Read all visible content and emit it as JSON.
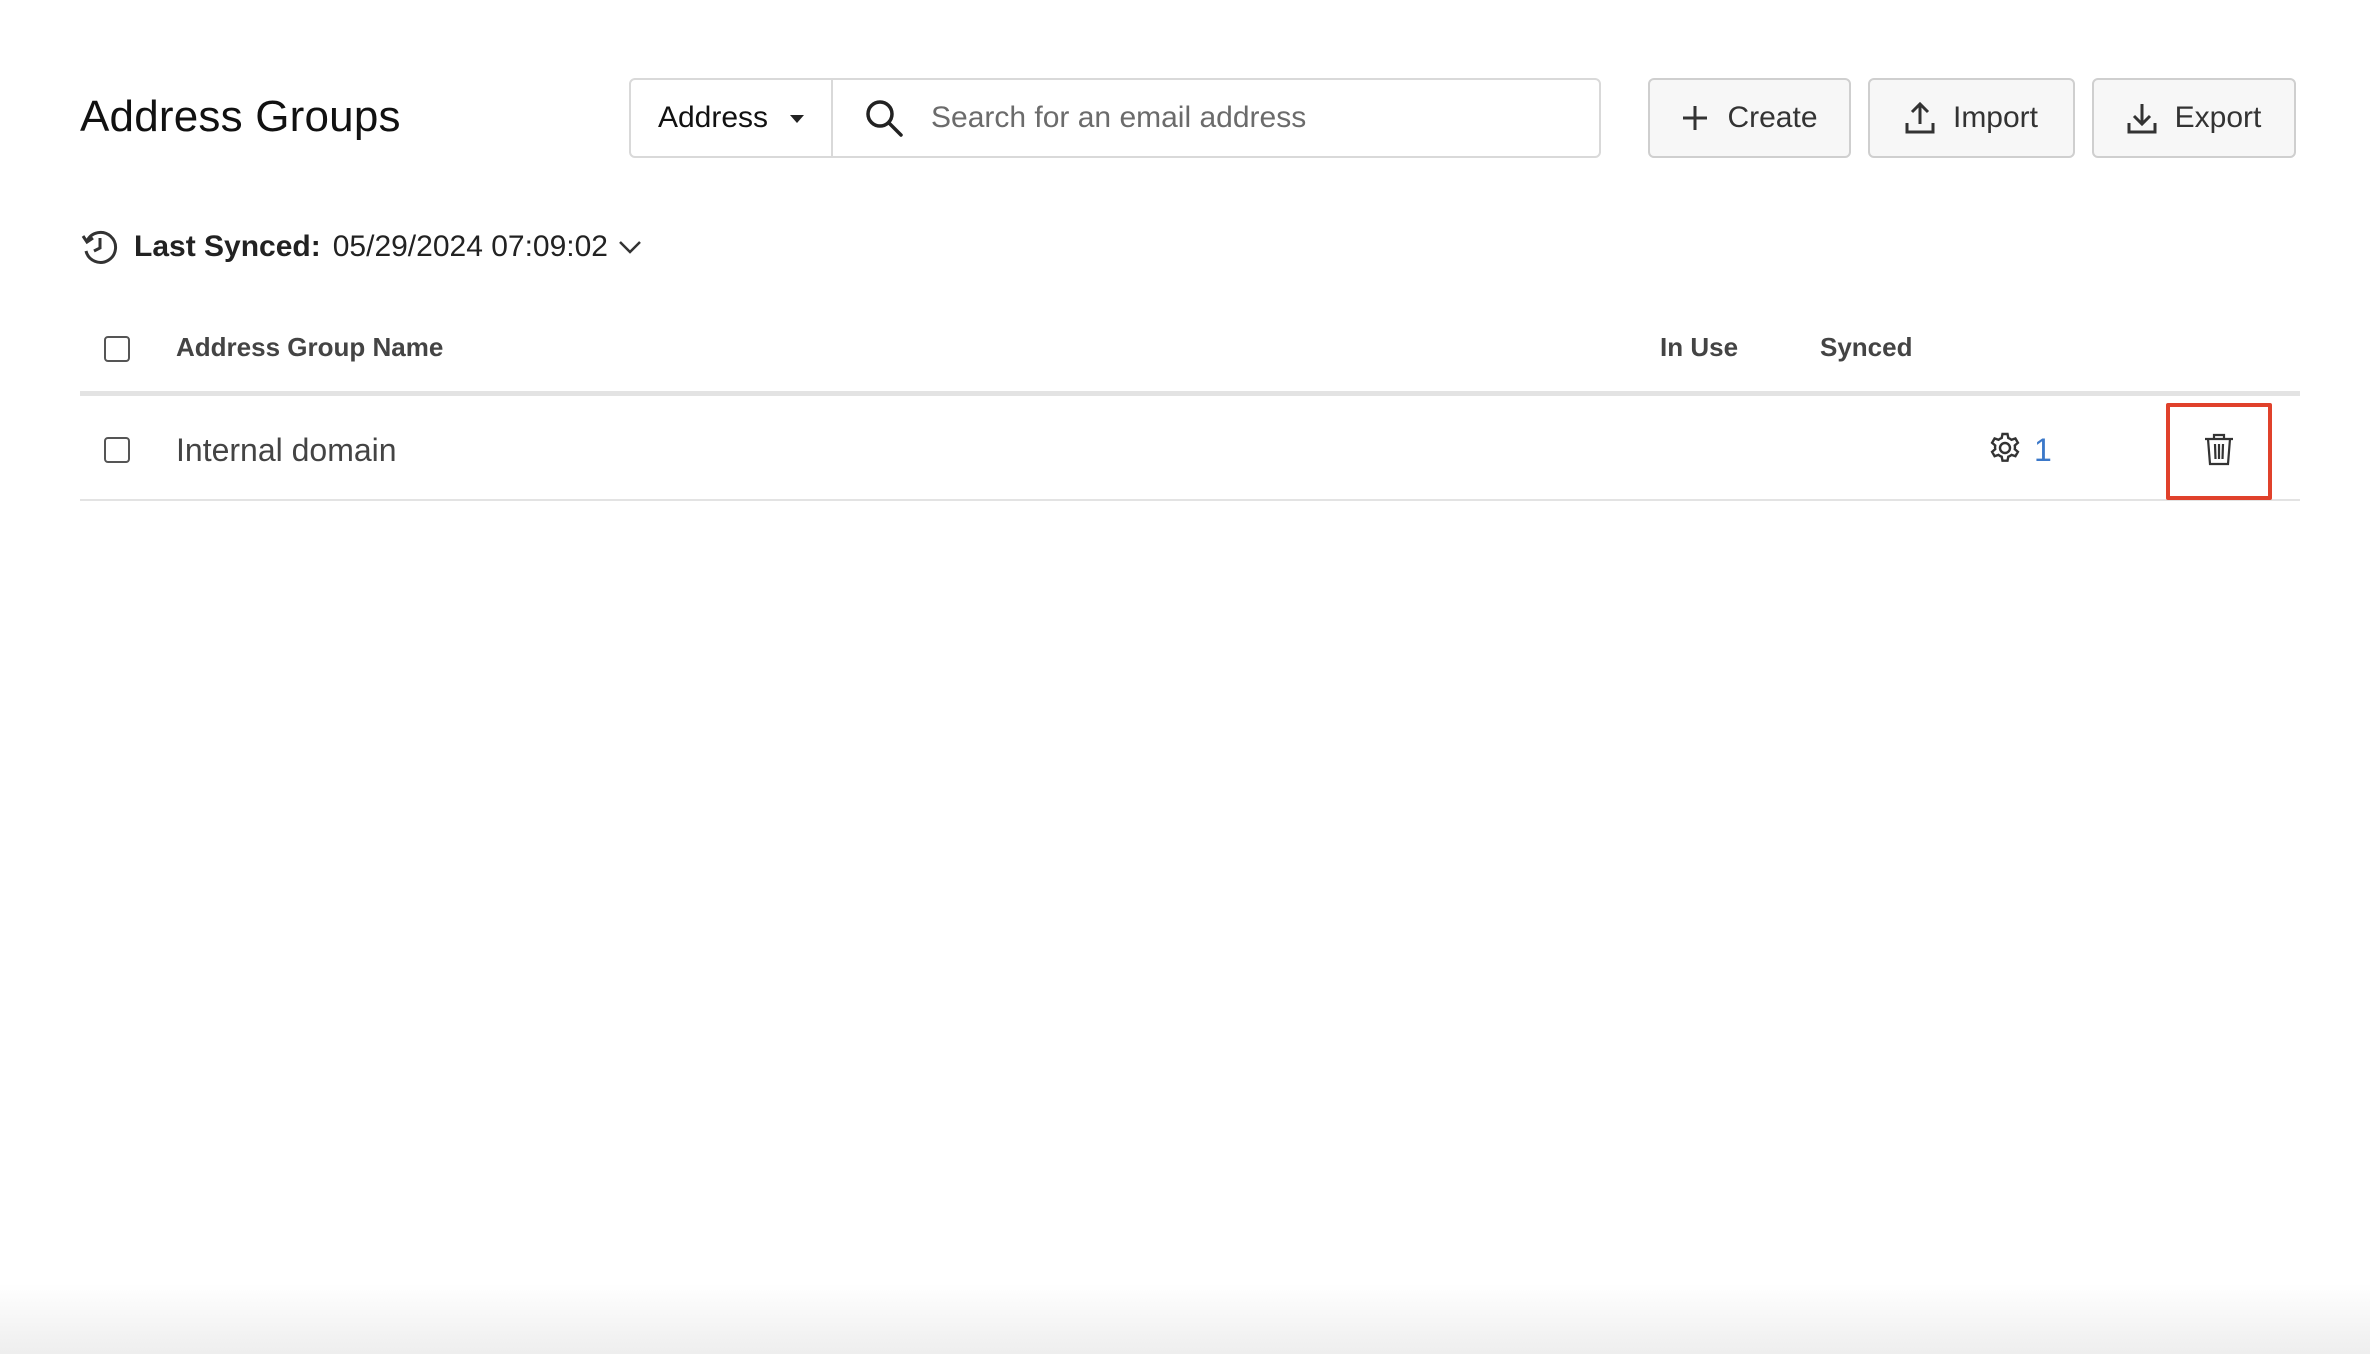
{
  "header": {
    "title": "Address Groups"
  },
  "search": {
    "type_selected": "Address",
    "placeholder": "Search for an email address",
    "value": ""
  },
  "actions": {
    "create_label": "Create",
    "import_label": "Import",
    "export_label": "Export"
  },
  "sync": {
    "label": "Last Synced:",
    "timestamp": "05/29/2024 07:09:02"
  },
  "table": {
    "columns": [
      "Address Group Name",
      "In Use",
      "Synced"
    ],
    "rows": [
      {
        "name": "Internal domain",
        "usage_count": "1"
      }
    ]
  },
  "colors": {
    "accent_link": "#3b78c9",
    "highlight": "#e0412b"
  }
}
